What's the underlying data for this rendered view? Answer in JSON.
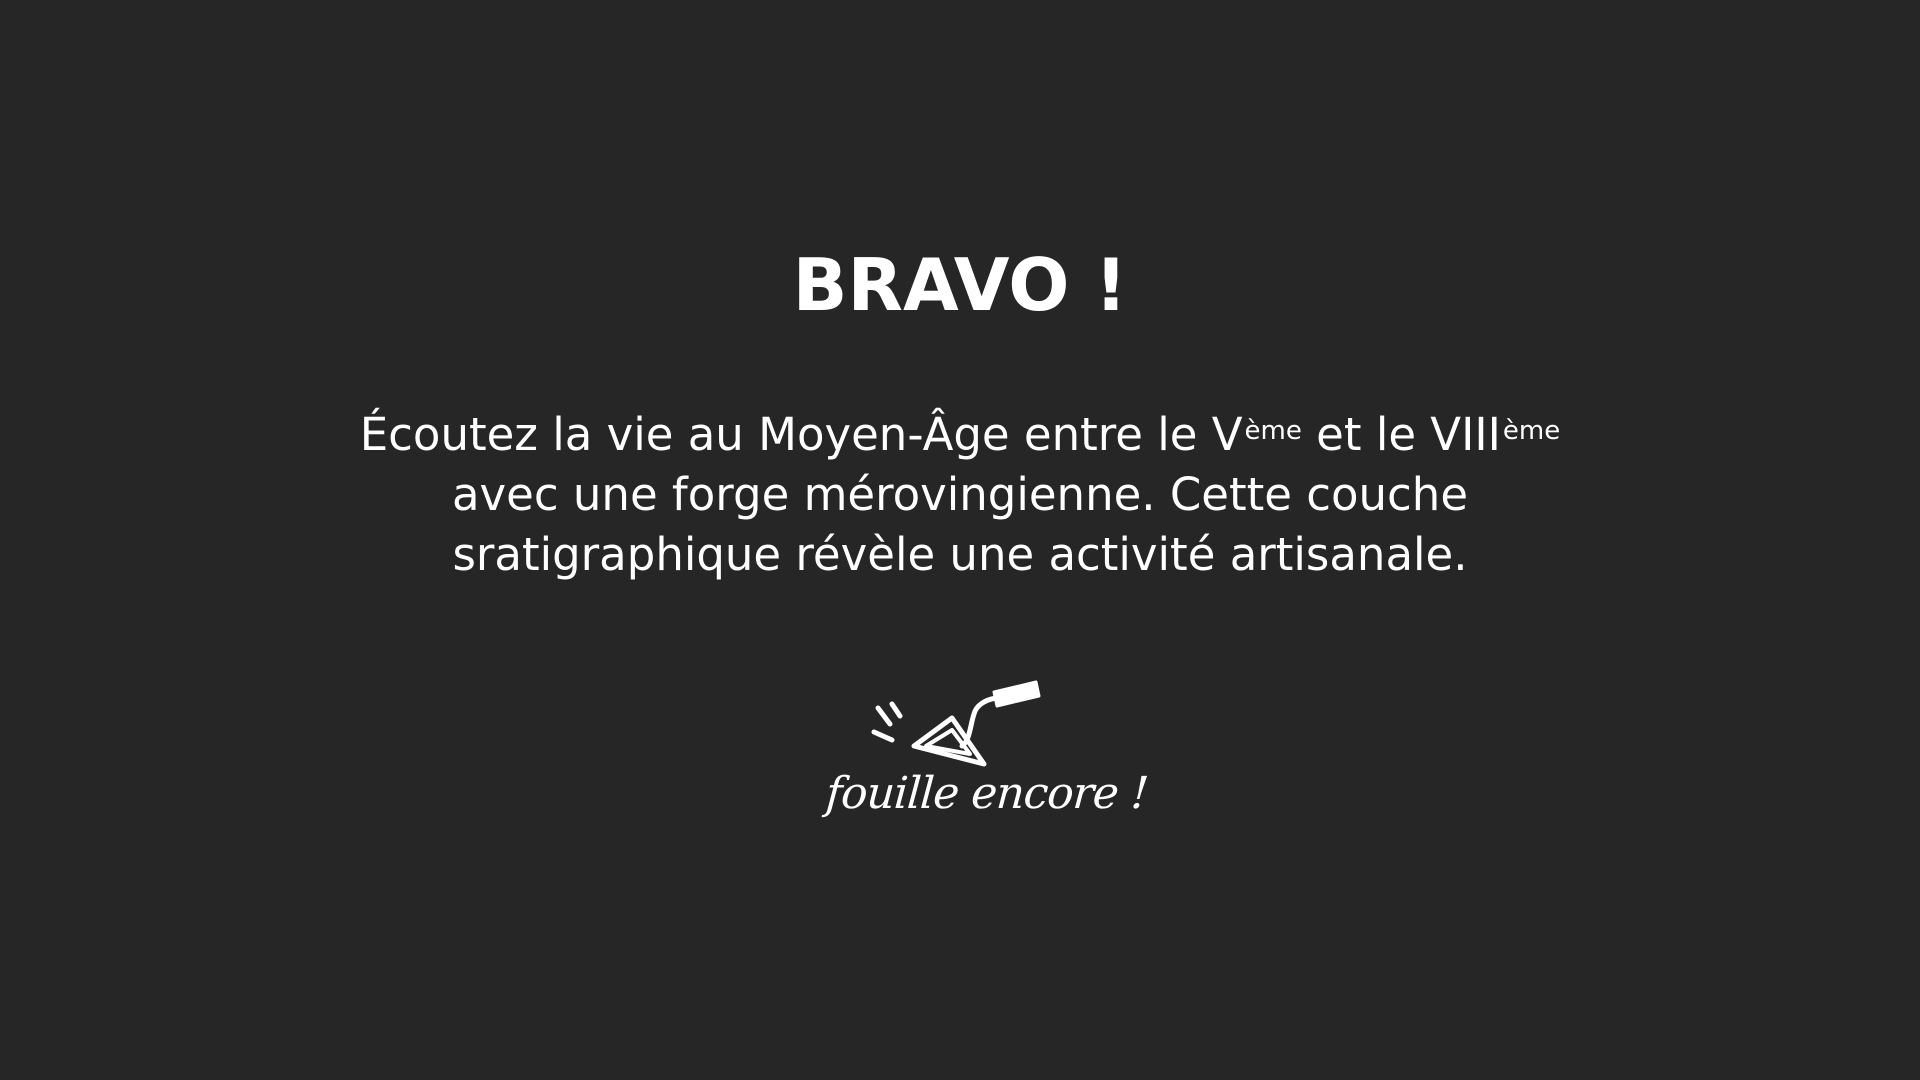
{
  "slide": {
    "background_color": "#262626",
    "text_color": "#ffffff",
    "title": "BRAVO !",
    "message": {
      "line1_part1": "Écoutez la vie au Moyen-Âge entre le V",
      "line1_sup1": "ème",
      "line1_part2": " et le VIII",
      "line1_sup2": "ème",
      "line2": "avec une forge mérovingienne. Cette couche",
      "line3": "sratigraphique révèle une activité artisanale."
    },
    "dig_again": {
      "icon": "trowel-icon",
      "label": "fouille encore !"
    }
  }
}
